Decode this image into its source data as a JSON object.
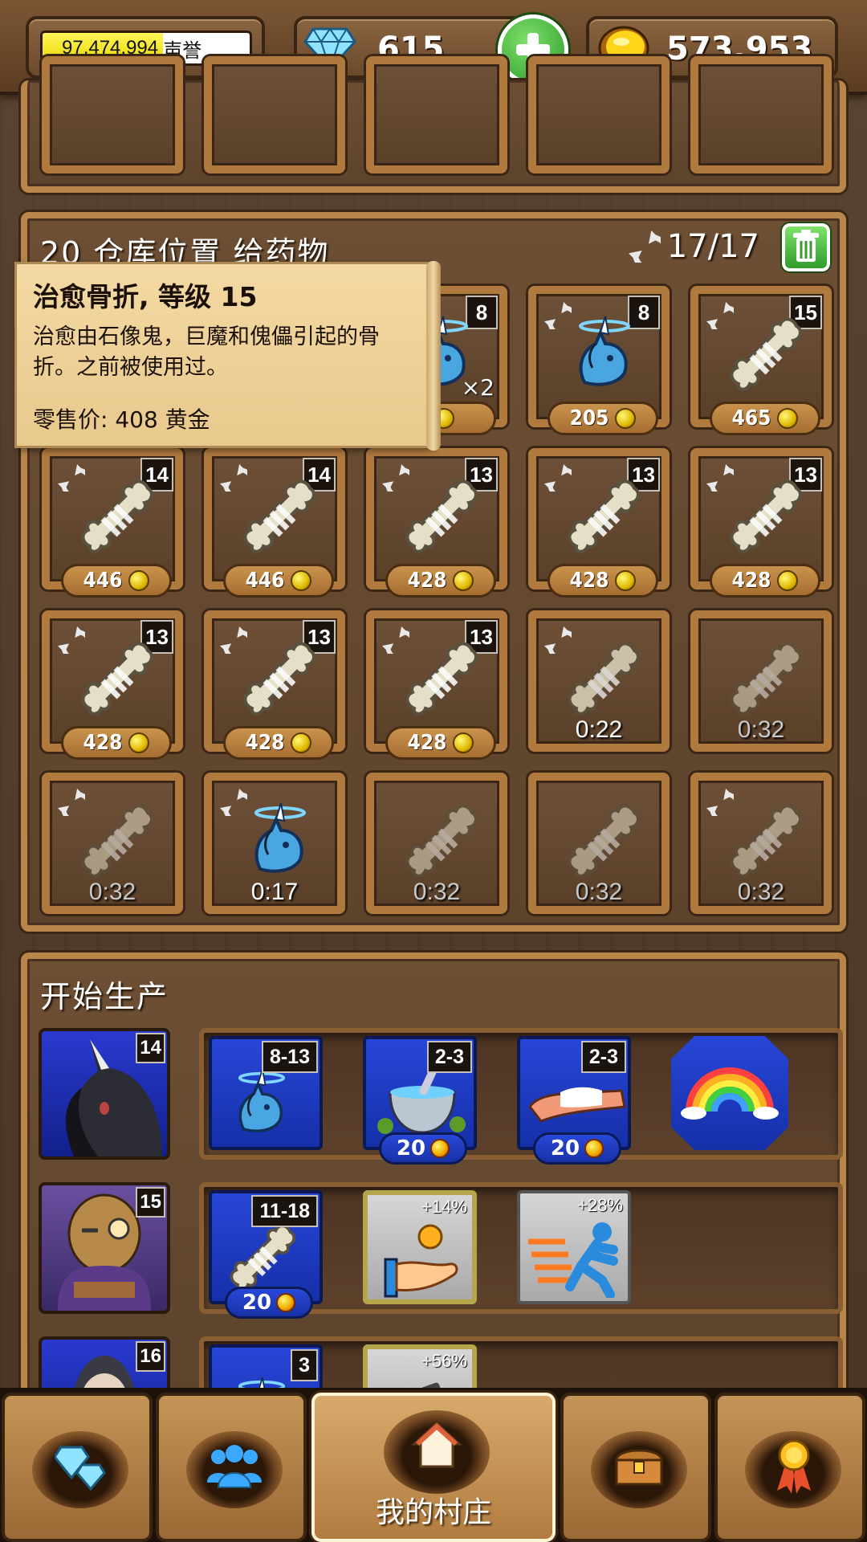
{
  "topbar": {
    "reputation_value": "97,474,994",
    "reputation_label": "声誉",
    "reputation_fill": 0.58,
    "gems": "615",
    "gold": "573,953"
  },
  "storage": {
    "title": "20 仓库位置 给药物",
    "capacity": "17/17"
  },
  "tooltip": {
    "title": "治愈骨折, 等级 15",
    "description": "治愈由石像鬼，巨魔和傀儡引起的骨折。之前被使用过。",
    "price": "零售价: 408 黄金"
  },
  "slots_row1": [
    {
      "level": "8",
      "price": "",
      "multiplier": "×2",
      "item": "unicorn-potion"
    },
    {
      "level": "8",
      "price": "205",
      "item": "unicorn-potion"
    },
    {
      "level": "15",
      "price": "465",
      "item": "bone"
    }
  ],
  "slots_row2": [
    {
      "level": "14",
      "price": "446"
    },
    {
      "level": "14",
      "price": "446"
    },
    {
      "level": "13",
      "price": "428"
    },
    {
      "level": "13",
      "price": "428"
    },
    {
      "level": "13",
      "price": "428"
    }
  ],
  "slots_row3": [
    {
      "level": "13",
      "price": "428"
    },
    {
      "level": "13",
      "price": "428"
    },
    {
      "level": "13",
      "price": "428"
    },
    {
      "timer": "0:22"
    },
    {
      "timer": "0:32"
    }
  ],
  "slots_row4": [
    {
      "timer": "0:32"
    },
    {
      "timer": "0:17"
    },
    {
      "timer": "0:32"
    },
    {
      "timer": "0:32"
    },
    {
      "timer": "0:32"
    }
  ],
  "production": {
    "title": "开始生产",
    "rows": [
      {
        "worker_level": "14",
        "recipes": [
          {
            "range": "8-13",
            "cost": ""
          },
          {
            "range": "2-3",
            "cost": "20"
          },
          {
            "range": "2-3",
            "cost": "20"
          }
        ]
      },
      {
        "worker_level": "15",
        "recipes": [
          {
            "range": "11-18",
            "cost": "20"
          }
        ],
        "boosts": [
          "+14%",
          "+28%"
        ]
      },
      {
        "worker_level": "16",
        "recipes": [
          {
            "range": "3",
            "cost": ""
          }
        ],
        "boosts": [
          "+56%"
        ]
      }
    ]
  },
  "nav": {
    "home_label": "我的村庄"
  }
}
